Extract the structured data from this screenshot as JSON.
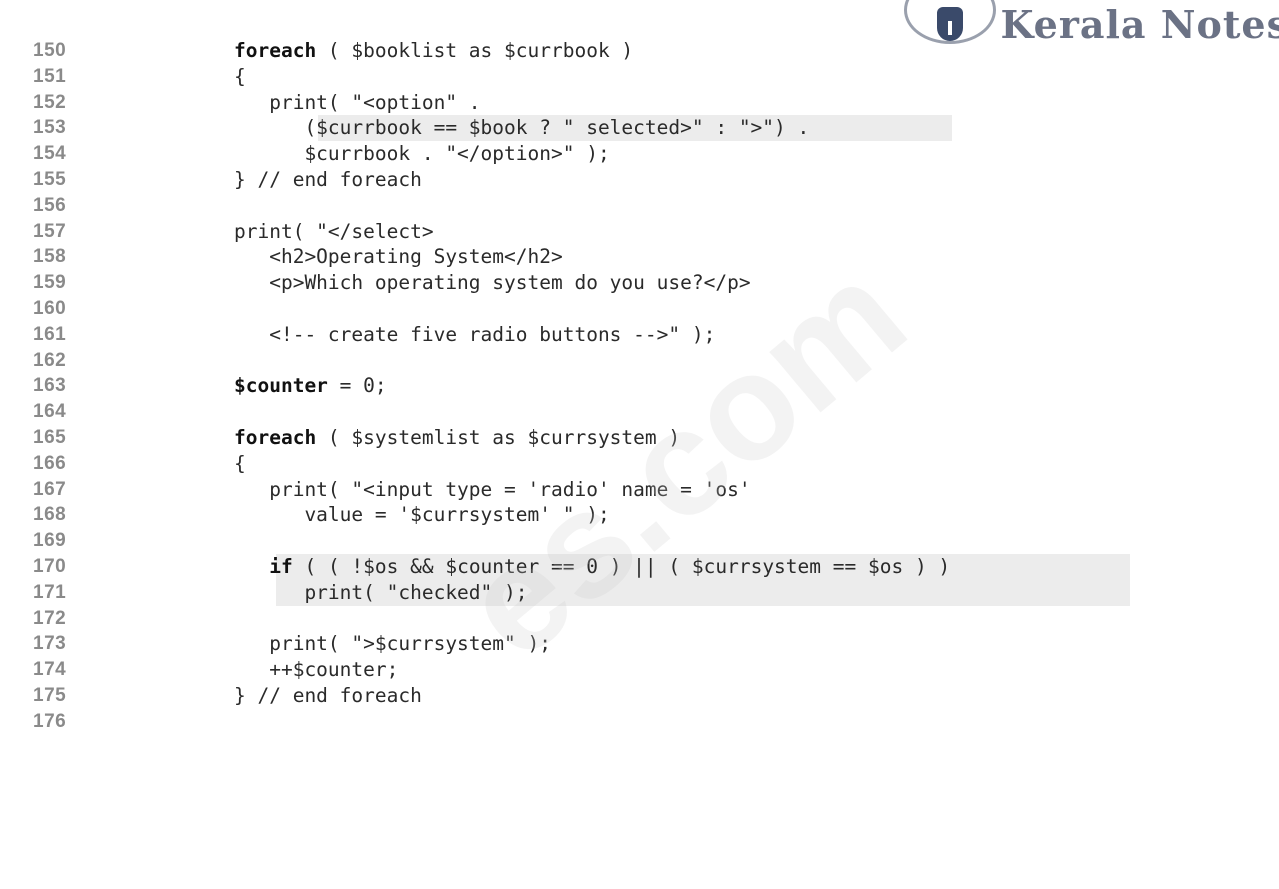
{
  "logo": {
    "text": "Kerala Notes"
  },
  "watermark": {
    "text": "es.com"
  },
  "code": {
    "lines": [
      {
        "n": "150",
        "text": "foreach ( $booklist as $currbook )",
        "bold": "foreach"
      },
      {
        "n": "151",
        "text": "{"
      },
      {
        "n": "152",
        "text": "   print( \"<option\" ."
      },
      {
        "n": "153",
        "text": "      ($currbook == $book ? \" selected>\" : \">\") .",
        "highlight": [
          318,
          952
        ]
      },
      {
        "n": "154",
        "text": "      $currbook . \"</option>\" );"
      },
      {
        "n": "155",
        "text": "} // end foreach"
      },
      {
        "n": "156",
        "text": ""
      },
      {
        "n": "157",
        "text": "print( \"</select>"
      },
      {
        "n": "158",
        "text": "   <h2>Operating System</h2>"
      },
      {
        "n": "159",
        "text": "   <p>Which operating system do you use?</p>"
      },
      {
        "n": "160",
        "text": ""
      },
      {
        "n": "161",
        "text": "   <!-- create five radio buttons -->\" );"
      },
      {
        "n": "162",
        "text": ""
      },
      {
        "n": "163",
        "text": "$counter = 0;",
        "bold": "$counter"
      },
      {
        "n": "164",
        "text": ""
      },
      {
        "n": "165",
        "text": "foreach ( $systemlist as $currsystem )",
        "bold": "foreach"
      },
      {
        "n": "166",
        "text": "{"
      },
      {
        "n": "167",
        "text": "   print( \"<input type = 'radio' name = 'os'"
      },
      {
        "n": "168",
        "text": "      value = '$currsystem' \" );"
      },
      {
        "n": "169",
        "text": ""
      },
      {
        "n": "170",
        "text": "   if ( ( !$os && $counter == 0 ) || ( $currsystem == $os ) )",
        "bold": "if",
        "highlight": [
          276,
          1130
        ]
      },
      {
        "n": "171",
        "text": "      print( \"checked\" );",
        "highlight": [
          276,
          1130
        ]
      },
      {
        "n": "172",
        "text": ""
      },
      {
        "n": "173",
        "text": "   print( \">$currsystem\" );"
      },
      {
        "n": "174",
        "text": "   ++$counter;"
      },
      {
        "n": "175",
        "text": "} // end foreach"
      },
      {
        "n": "176",
        "text": ""
      }
    ]
  }
}
